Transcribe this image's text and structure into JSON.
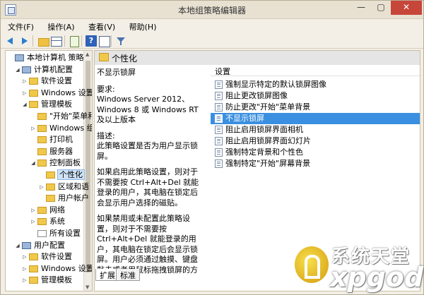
{
  "window": {
    "title": "本地组策略编辑器",
    "minimize": "—",
    "maximize": "▢",
    "close": "✕"
  },
  "menu": [
    "文件(F)",
    "操作(A)",
    "查看(V)",
    "帮助(H)"
  ],
  "toolbar": {
    "help": "?",
    "icons": [
      "arrow-left-icon",
      "arrow-right-icon",
      "folder-up-icon",
      "show-hide-tree-icon",
      "export-list-icon",
      "help-icon",
      "properties-icon",
      "filter-icon"
    ]
  },
  "tree": [
    {
      "label": "本地计算机 策略",
      "level": 0,
      "expander": "",
      "icon": "pc"
    },
    {
      "label": "计算机配置",
      "level": 1,
      "expander": "◢",
      "icon": "pc"
    },
    {
      "label": "软件设置",
      "level": 2,
      "expander": "▷",
      "icon": "folder"
    },
    {
      "label": "Windows 设置",
      "level": 2,
      "expander": "▷",
      "icon": "folder"
    },
    {
      "label": "管理模板",
      "level": 2,
      "expander": "◢",
      "icon": "folder"
    },
    {
      "label": "\"开始\"菜单和",
      "level": 3,
      "expander": "",
      "icon": "folder"
    },
    {
      "label": "Windows 组",
      "level": 3,
      "expander": "▷",
      "icon": "folder"
    },
    {
      "label": "打印机",
      "level": 3,
      "expander": "",
      "icon": "folder"
    },
    {
      "label": "服务器",
      "level": 3,
      "expander": "",
      "icon": "folder"
    },
    {
      "label": "控制面板",
      "level": 3,
      "expander": "◢",
      "icon": "folder"
    },
    {
      "label": "个性化",
      "level": 4,
      "expander": "",
      "icon": "folder",
      "selected": true
    },
    {
      "label": "区域和语",
      "level": 4,
      "expander": "▷",
      "icon": "folder"
    },
    {
      "label": "用户帐户",
      "level": 4,
      "expander": "",
      "icon": "folder"
    },
    {
      "label": "网络",
      "level": 3,
      "expander": "▷",
      "icon": "folder"
    },
    {
      "label": "系统",
      "level": 3,
      "expander": "▷",
      "icon": "folder"
    },
    {
      "label": "所有设置",
      "level": 3,
      "expander": "",
      "icon": "doc"
    },
    {
      "label": "用户配置",
      "level": 1,
      "expander": "◢",
      "icon": "pc"
    },
    {
      "label": "软件设置",
      "level": 2,
      "expander": "▷",
      "icon": "folder"
    },
    {
      "label": "Windows 设置",
      "level": 2,
      "expander": "▷",
      "icon": "folder"
    },
    {
      "label": "管理模板",
      "level": 2,
      "expander": "▷",
      "icon": "folder"
    }
  ],
  "right": {
    "header": "个性化",
    "description": {
      "title": "不显示锁屏",
      "requirements_label": "要求:",
      "requirements": "Windows Server 2012、Windows 8 或 Windows RT 及以上版本",
      "desc_label": "描述:",
      "desc": "此策略设置是否为用户显示锁屏。",
      "enabled": "如果启用此策略设置，则对于不需要按 Ctrl+Alt+Del 就能登录的用户，其电脑在锁定后会显示用户选择的磁贴。",
      "disabled": "如果禁用或未配置此策略设置，则对于不需要按 Ctrl+Alt+Del 就能登录的用户，其电脑在锁定后会显示锁屏。用户必须通过触摸、键盘敲击或者用鼠标拖拽锁屏的方式取消锁屏。"
    },
    "list_header": "设置",
    "settings": [
      {
        "label": "强制显示特定的默认锁屏图像",
        "selected": false
      },
      {
        "label": "阻止更改锁屏图像",
        "selected": false
      },
      {
        "label": "防止更改\"开始\"菜单背景",
        "selected": false
      },
      {
        "label": "不显示锁屏",
        "selected": true
      },
      {
        "label": "阻止启用锁屏界面相机",
        "selected": false
      },
      {
        "label": "阻止启用锁屏界面幻灯片",
        "selected": false
      },
      {
        "label": "强制特定背景和个性色",
        "selected": false
      },
      {
        "label": "强制特定\"开始\"屏幕背景",
        "selected": false
      }
    ]
  },
  "tabs": [
    {
      "label": "扩展",
      "active": true
    },
    {
      "label": "标准",
      "active": false
    }
  ],
  "watermark": {
    "cn": "系统天堂",
    "en": "xpgod"
  }
}
